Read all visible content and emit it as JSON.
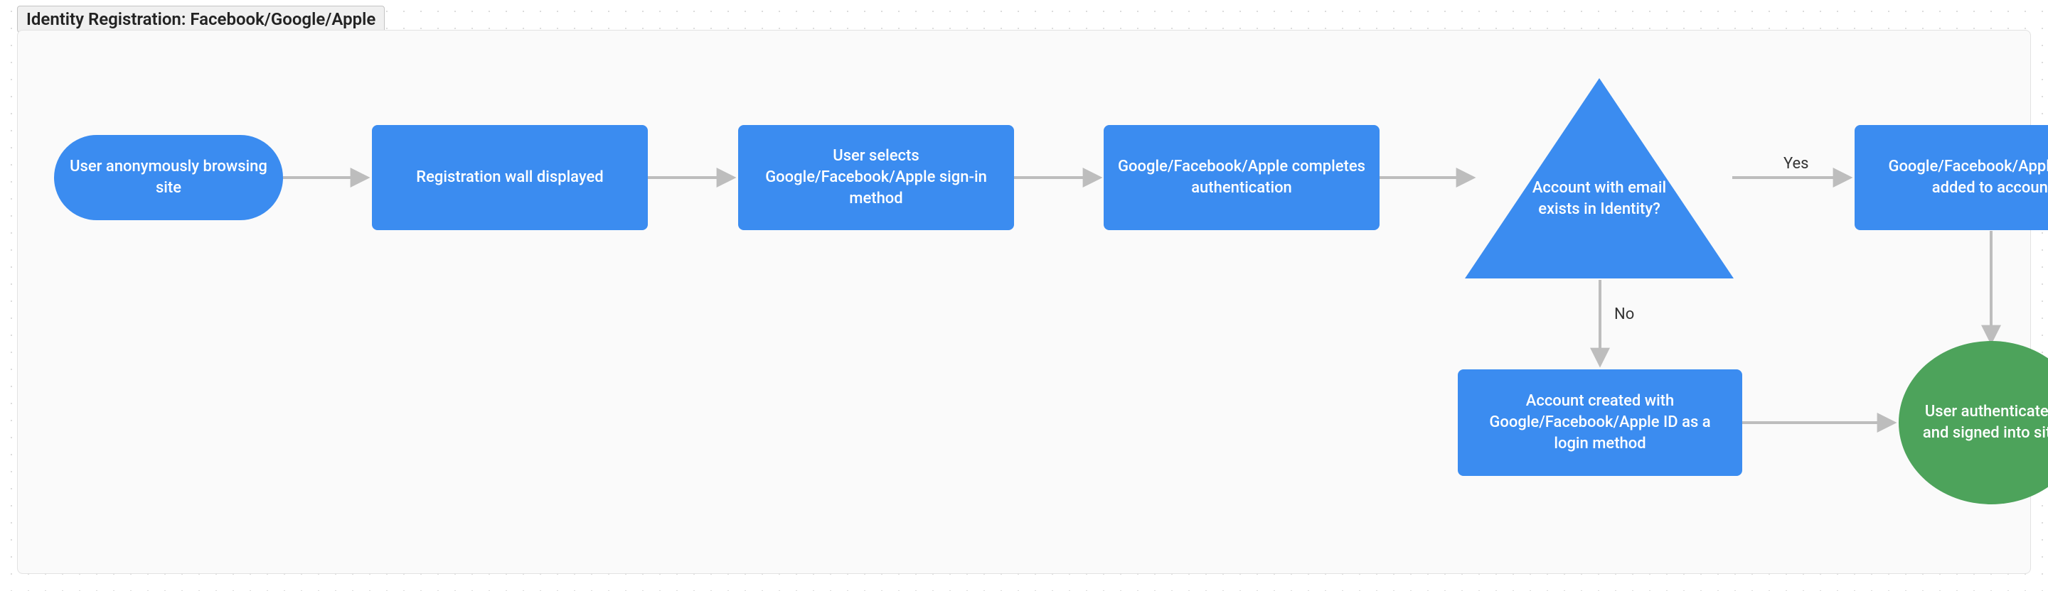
{
  "frame_title": "Identity Registration: Facebook/Google/Apple",
  "nodes": {
    "n1": "User anonymously browsing site",
    "n2": "Registration wall displayed",
    "n3": "User selects Google/Facebook/Apple sign-in method",
    "n4": "Google/Facebook/Apple completes authentication",
    "n5": "Account with email exists in Identity?",
    "n6": "Google/Facebook/Apple login added to account",
    "n7": "Account created with Google/Facebook/Apple ID as a login method",
    "n8": "User authenticated and signed into site"
  },
  "edge_labels": {
    "yes": "Yes",
    "no": "No"
  },
  "colors": {
    "process": "#3b8cf0",
    "terminal": "#4da35b",
    "arrow": "#bdbdbd",
    "label": "#333333"
  },
  "chart_data": {
    "type": "flowchart",
    "title": "Identity Registration: Facebook/Google/Apple",
    "nodes": [
      {
        "id": "n1",
        "shape": "stadium",
        "fill": "#3b8cf0",
        "text": "User anonymously browsing site"
      },
      {
        "id": "n2",
        "shape": "rect",
        "fill": "#3b8cf0",
        "text": "Registration wall displayed"
      },
      {
        "id": "n3",
        "shape": "rect",
        "fill": "#3b8cf0",
        "text": "User selects Google/Facebook/Apple sign-in method"
      },
      {
        "id": "n4",
        "shape": "rect",
        "fill": "#3b8cf0",
        "text": "Google/Facebook/Apple completes authentication"
      },
      {
        "id": "n5",
        "shape": "triangle",
        "fill": "#3b8cf0",
        "text": "Account with email exists in Identity?"
      },
      {
        "id": "n6",
        "shape": "rect",
        "fill": "#3b8cf0",
        "text": "Google/Facebook/Apple login added to account"
      },
      {
        "id": "n7",
        "shape": "rect",
        "fill": "#3b8cf0",
        "text": "Account created with Google/Facebook/Apple ID as a login method"
      },
      {
        "id": "n8",
        "shape": "ellipse",
        "fill": "#4da35b",
        "text": "User authenticated and signed into site"
      }
    ],
    "edges": [
      {
        "from": "n1",
        "to": "n2"
      },
      {
        "from": "n2",
        "to": "n3"
      },
      {
        "from": "n3",
        "to": "n4"
      },
      {
        "from": "n4",
        "to": "n5"
      },
      {
        "from": "n5",
        "to": "n6",
        "label": "Yes"
      },
      {
        "from": "n5",
        "to": "n7",
        "label": "No"
      },
      {
        "from": "n6",
        "to": "n8"
      },
      {
        "from": "n7",
        "to": "n8"
      }
    ]
  }
}
